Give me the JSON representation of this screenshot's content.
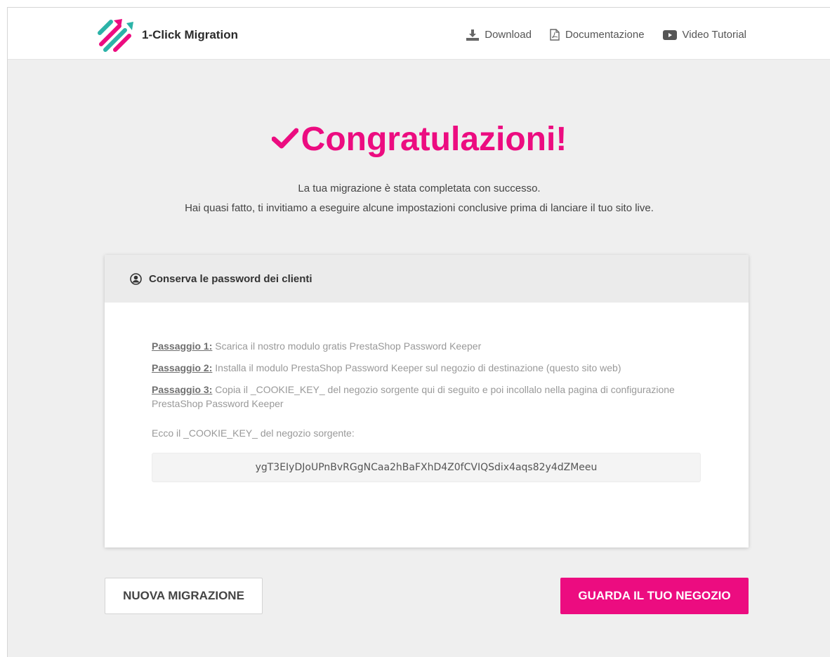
{
  "header": {
    "brand_name": "1-Click Migration",
    "nav": [
      {
        "label": "Download",
        "icon": "download-icon"
      },
      {
        "label": "Documentazione",
        "icon": "pdf-file-icon"
      },
      {
        "label": "Video Tutorial",
        "icon": "video-play-icon"
      }
    ]
  },
  "main": {
    "title": "Congratulazioni!",
    "subtitle_line1": "La tua migrazione è stata completata con successo.",
    "subtitle_line2": "Hai quasi fatto, ti invitiamo a eseguire alcune impostazioni conclusive prima di lanciare il tuo sito live."
  },
  "card": {
    "header": "Conserva le password dei clienti",
    "steps": [
      {
        "label": "Passaggio 1:",
        "text": " Scarica il nostro modulo gratis PrestaShop Password Keeper"
      },
      {
        "label": "Passaggio 2:",
        "text": " Installa il modulo PrestaShop Password Keeper sul negozio di destinazione (questo sito web)"
      },
      {
        "label": "Passaggio 3:",
        "text": " Copia il _COOKIE_KEY_ del negozio sorgente qui di seguito e poi incollalo nella pagina di configurazione PrestaShop Password Keeper"
      }
    ],
    "key_label": "Ecco il _COOKIE_KEY_ del negozio sorgente:",
    "cookie_key": "ygT3EIyDJoUPnBvRGgNCaa2hBaFXhD4Z0fCVIQSdix4aqs82y4dZMeeu"
  },
  "buttons": {
    "new_migration": "NUOVA MIGRAZIONE",
    "view_shop": "GUARDA IL TUO NEGOZIO"
  },
  "colors": {
    "accent": "#ec0c80",
    "logo_teal": "#2bb3a8",
    "background": "#efefef"
  }
}
